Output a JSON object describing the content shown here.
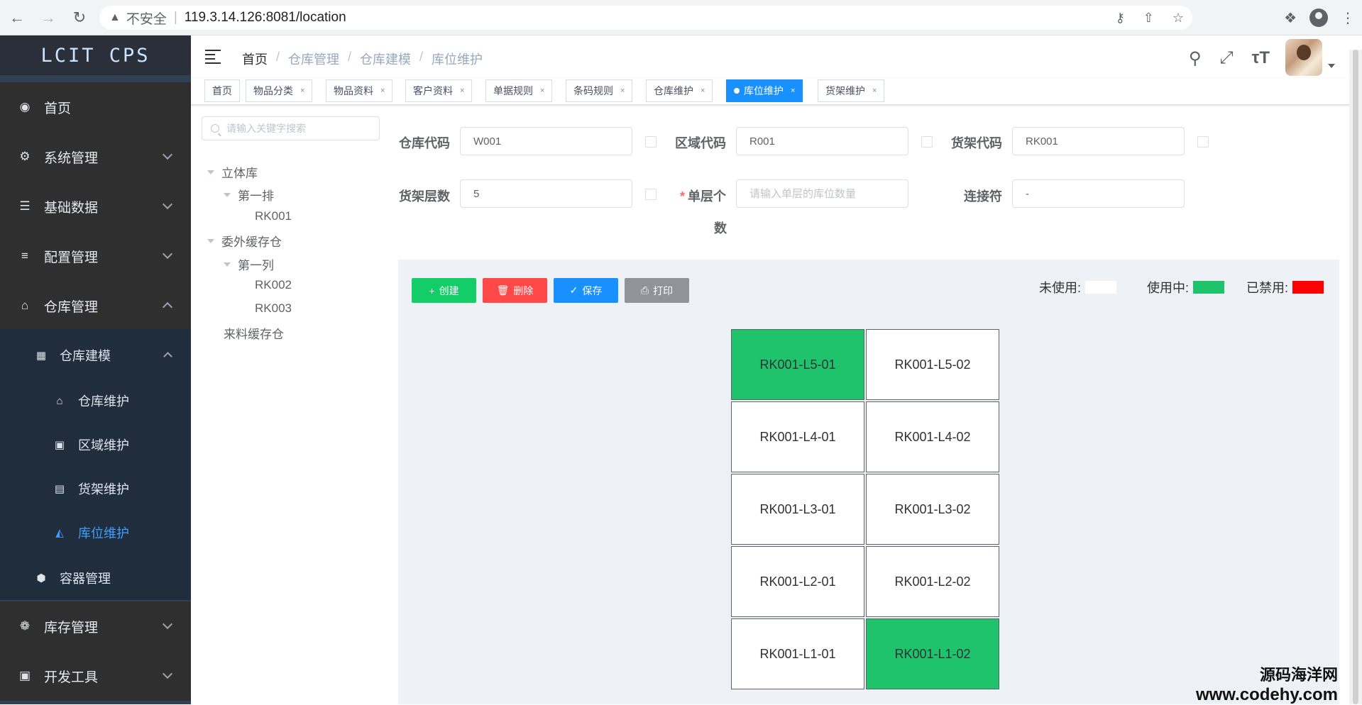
{
  "browser": {
    "insecure_label": "不安全",
    "url": "119.3.14.126:8081/location"
  },
  "sidebar": {
    "logo": "LCIT CPS",
    "items": [
      {
        "label": "首页"
      },
      {
        "label": "系统管理"
      },
      {
        "label": "基础数据"
      },
      {
        "label": "配置管理"
      },
      {
        "label": "仓库管理"
      },
      {
        "label": "仓库建模"
      },
      {
        "label": "仓库维护"
      },
      {
        "label": "区域维护"
      },
      {
        "label": "货架维护"
      },
      {
        "label": "库位维护"
      },
      {
        "label": "容器管理"
      },
      {
        "label": "库存管理"
      },
      {
        "label": "开发工具"
      }
    ]
  },
  "breadcrumb": [
    "首页",
    "仓库管理",
    "仓库建模",
    "库位维护"
  ],
  "tags": [
    {
      "label": "首页"
    },
    {
      "label": "物品分类"
    },
    {
      "label": "物品资料"
    },
    {
      "label": "客户资料"
    },
    {
      "label": "单据规则"
    },
    {
      "label": "条码规则"
    },
    {
      "label": "仓库维护"
    },
    {
      "label": "库位维护"
    },
    {
      "label": "货架维护"
    }
  ],
  "tree": {
    "search_placeholder": "请输入关键字搜索",
    "nodes": [
      "立体库",
      "第一排",
      "RK001",
      "委外缓存仓",
      "第一列",
      "RK002",
      "RK003",
      "来料缓存仓"
    ]
  },
  "form": {
    "warehouse_code_label": "仓库代码",
    "warehouse_code": "W001",
    "area_code_label": "区域代码",
    "area_code": "R001",
    "shelf_code_label": "货架代码",
    "shelf_code": "RK001",
    "shelf_layers_label": "货架层数",
    "shelf_layers": "5",
    "single_layer_label_1": "单层个",
    "single_layer_label_2": "数",
    "single_layer_placeholder": "请输入单层的库位数量",
    "connector_label": "连接符",
    "connector": "-"
  },
  "toolbar": {
    "create": "创建",
    "delete": "删除",
    "save": "保存",
    "print": "打印"
  },
  "legend": {
    "unused": "未使用:",
    "unused_color": "#ffffff",
    "in_use": "使用中:",
    "in_use_color": "#1fc36c",
    "disabled": "已禁用:",
    "disabled_color": "#ff0000"
  },
  "locations": [
    {
      "code": "RK001-L5-01",
      "status": "used"
    },
    {
      "code": "RK001-L5-02",
      "status": "unused"
    },
    {
      "code": "RK001-L4-01",
      "status": "unused"
    },
    {
      "code": "RK001-L4-02",
      "status": "unused"
    },
    {
      "code": "RK001-L3-01",
      "status": "unused"
    },
    {
      "code": "RK001-L3-02",
      "status": "unused"
    },
    {
      "code": "RK001-L2-01",
      "status": "unused"
    },
    {
      "code": "RK001-L2-02",
      "status": "unused"
    },
    {
      "code": "RK001-L1-01",
      "status": "unused"
    },
    {
      "code": "RK001-L1-02",
      "status": "used"
    }
  ],
  "watermark": {
    "line1": "源码海洋网",
    "line2": "www.codehy.com"
  }
}
